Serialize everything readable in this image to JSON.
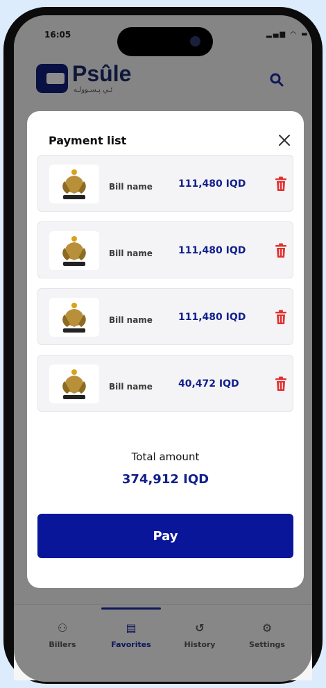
{
  "status_bar": {
    "time": "16:05",
    "icons": "signal-wifi-battery"
  },
  "app": {
    "brand": "Psûle",
    "brand_subtitle": "ئـي پـسـوولـه"
  },
  "modal": {
    "title": "Payment list",
    "bills": [
      {
        "name": "Bill name",
        "amount": "111,480 IQD",
        "logo": "emblem-logo"
      },
      {
        "name": "Bill name",
        "amount": "111,480 IQD",
        "logo": "emblem-logo"
      },
      {
        "name": "Bill name",
        "amount": "111,480 IQD",
        "logo": "emblem-logo"
      },
      {
        "name": "Bill name",
        "amount": "40,472 IQD",
        "logo": "emblem-logo"
      }
    ],
    "total_label": "Total amount",
    "total_value": "374,912 IQD",
    "pay_label": "Pay"
  },
  "tabbar": {
    "tabs": [
      {
        "label": "Billers",
        "icon": "billers-icon"
      },
      {
        "label": "Favorites",
        "icon": "favorites-icon",
        "active": true
      },
      {
        "label": "History",
        "icon": "history-icon"
      },
      {
        "label": "Settings",
        "icon": "settings-icon"
      }
    ]
  },
  "colors": {
    "accent": "#0a169a",
    "amount": "#12208c",
    "delete": "#e03131"
  }
}
